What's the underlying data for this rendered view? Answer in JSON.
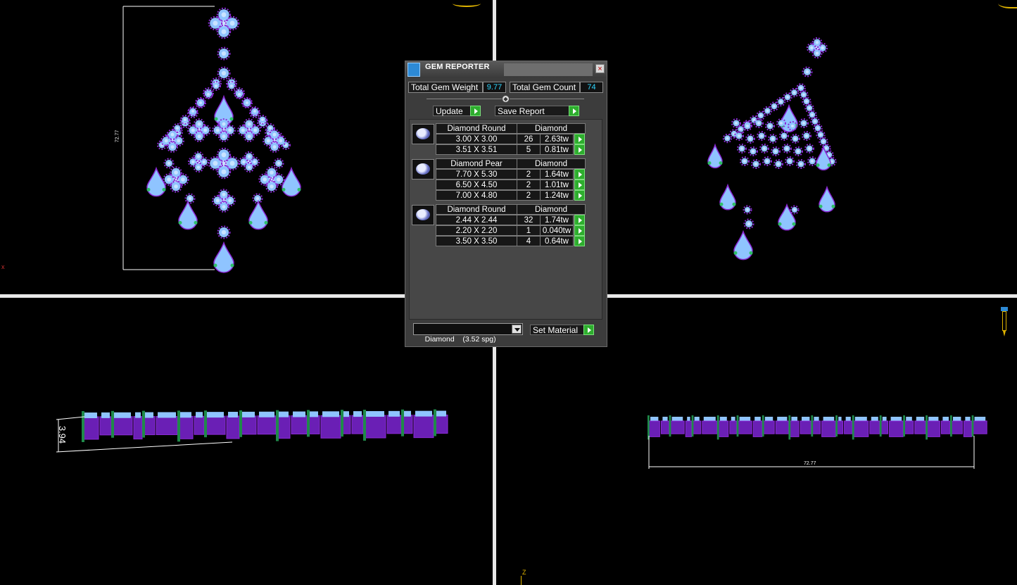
{
  "viewports": {
    "top_left": {
      "dimension_label": "72.77"
    },
    "bottom_left": {
      "dimension_label": "3.94"
    },
    "bottom_right": {
      "dimension_label": "72.77",
      "axis_label": "Z"
    },
    "left_axis_marker": "x"
  },
  "gem_reporter": {
    "title": "GEM REPORTER",
    "close": "×",
    "total_weight_label": "Total Gem Weight",
    "total_weight_value": "9.77",
    "total_count_label": "Total Gem Count",
    "total_count_value": "74",
    "update_label": "Update",
    "save_report_label": "Save Report",
    "groups": [
      {
        "shape": "Diamond Round",
        "material": "Diamond",
        "rows": [
          {
            "size": "3.00 X 3.00",
            "count": "26",
            "weight": "2.63tw"
          },
          {
            "size": "3.51 X 3.51",
            "count": "5",
            "weight": "0.81tw"
          }
        ]
      },
      {
        "shape": "Diamond Pear",
        "material": "Diamond",
        "rows": [
          {
            "size": "7.70 X 5.30",
            "count": "2",
            "weight": "1.64tw"
          },
          {
            "size": "6.50 X 4.50",
            "count": "2",
            "weight": "1.01tw"
          },
          {
            "size": "7.00 X 4.80",
            "count": "2",
            "weight": "1.24tw"
          }
        ]
      },
      {
        "shape": "Diamond Round",
        "material": "Diamond",
        "rows": [
          {
            "size": "2.44 X 2.44",
            "count": "32",
            "weight": "1.74tw"
          },
          {
            "size": "2.20 X 2.20",
            "count": "1",
            "weight": "0.040tw"
          },
          {
            "size": "3.50 X 3.50",
            "count": "4",
            "weight": "0.64tw"
          }
        ]
      }
    ],
    "material_select": "Diamond    (3.52 spg)",
    "set_material_label": "Set Material"
  },
  "colors": {
    "gem": "#8fc4ff",
    "prong": "#8b2bd6",
    "metal_green": "#1f8a4a",
    "accent_cyan": "#2fd6ff"
  }
}
